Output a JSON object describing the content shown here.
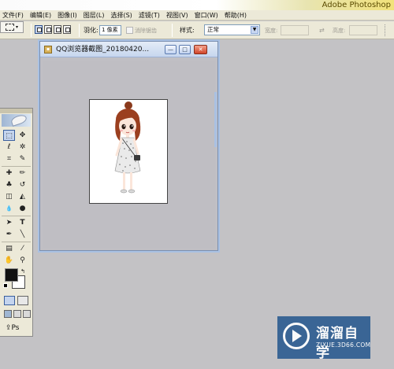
{
  "app": {
    "title": "Adobe Photoshop"
  },
  "menubar": {
    "items": [
      "文件(F)",
      "编辑(E)",
      "图像(I)",
      "图层(L)",
      "选择(S)",
      "滤镜(T)",
      "视图(V)",
      "窗口(W)",
      "帮助(H)"
    ]
  },
  "options": {
    "feather_label": "羽化:",
    "feather_value": "1 像素",
    "antialias_label": "消除锯齿",
    "style_label": "样式:",
    "style_value": "正常",
    "width_label": "宽度:",
    "height_label": "高度:",
    "swap_symbol": "⇄"
  },
  "document": {
    "title": "QQ浏览器截图_20180420...",
    "minimize_symbol": "—",
    "maximize_symbol": "□",
    "close_symbol": "✕"
  },
  "toolbox": {
    "tools": [
      {
        "name": "rectangular-marquee-tool",
        "glyph": "⬚"
      },
      {
        "name": "move-tool",
        "glyph": "✥"
      },
      {
        "name": "lasso-tool",
        "glyph": "ℓ"
      },
      {
        "name": "magic-wand-tool",
        "glyph": "✲"
      },
      {
        "name": "crop-tool",
        "glyph": "⌗"
      },
      {
        "name": "slice-tool",
        "glyph": "✎"
      },
      {
        "name": "healing-brush-tool",
        "glyph": "✚"
      },
      {
        "name": "brush-tool",
        "glyph": "✏"
      },
      {
        "name": "clone-stamp-tool",
        "glyph": "♣"
      },
      {
        "name": "history-brush-tool",
        "glyph": "↺"
      },
      {
        "name": "eraser-tool",
        "glyph": "◫"
      },
      {
        "name": "paint-bucket-tool",
        "glyph": "◭"
      },
      {
        "name": "blur-tool",
        "glyph": "💧"
      },
      {
        "name": "dodge-tool",
        "glyph": "●"
      },
      {
        "name": "path-selection-tool",
        "glyph": "➤"
      },
      {
        "name": "type-tool",
        "glyph": "T"
      },
      {
        "name": "pen-tool",
        "glyph": "✒"
      },
      {
        "name": "line-tool",
        "glyph": "╲"
      },
      {
        "name": "notes-tool",
        "glyph": "▤"
      },
      {
        "name": "eyedropper-tool",
        "glyph": "⁄"
      },
      {
        "name": "hand-tool",
        "glyph": "✋"
      },
      {
        "name": "zoom-tool",
        "glyph": "⚲"
      }
    ],
    "swap_symbol": "↰",
    "jump_symbol": "⇪Ps"
  },
  "watermark": {
    "name": "溜溜自学",
    "url": "ZIXUE.3D66.COM"
  },
  "colors": {
    "workspace": "#c3c2c5",
    "foreground": "#111111",
    "background": "#ffffff",
    "watermark_bg": "#2f5e92"
  }
}
